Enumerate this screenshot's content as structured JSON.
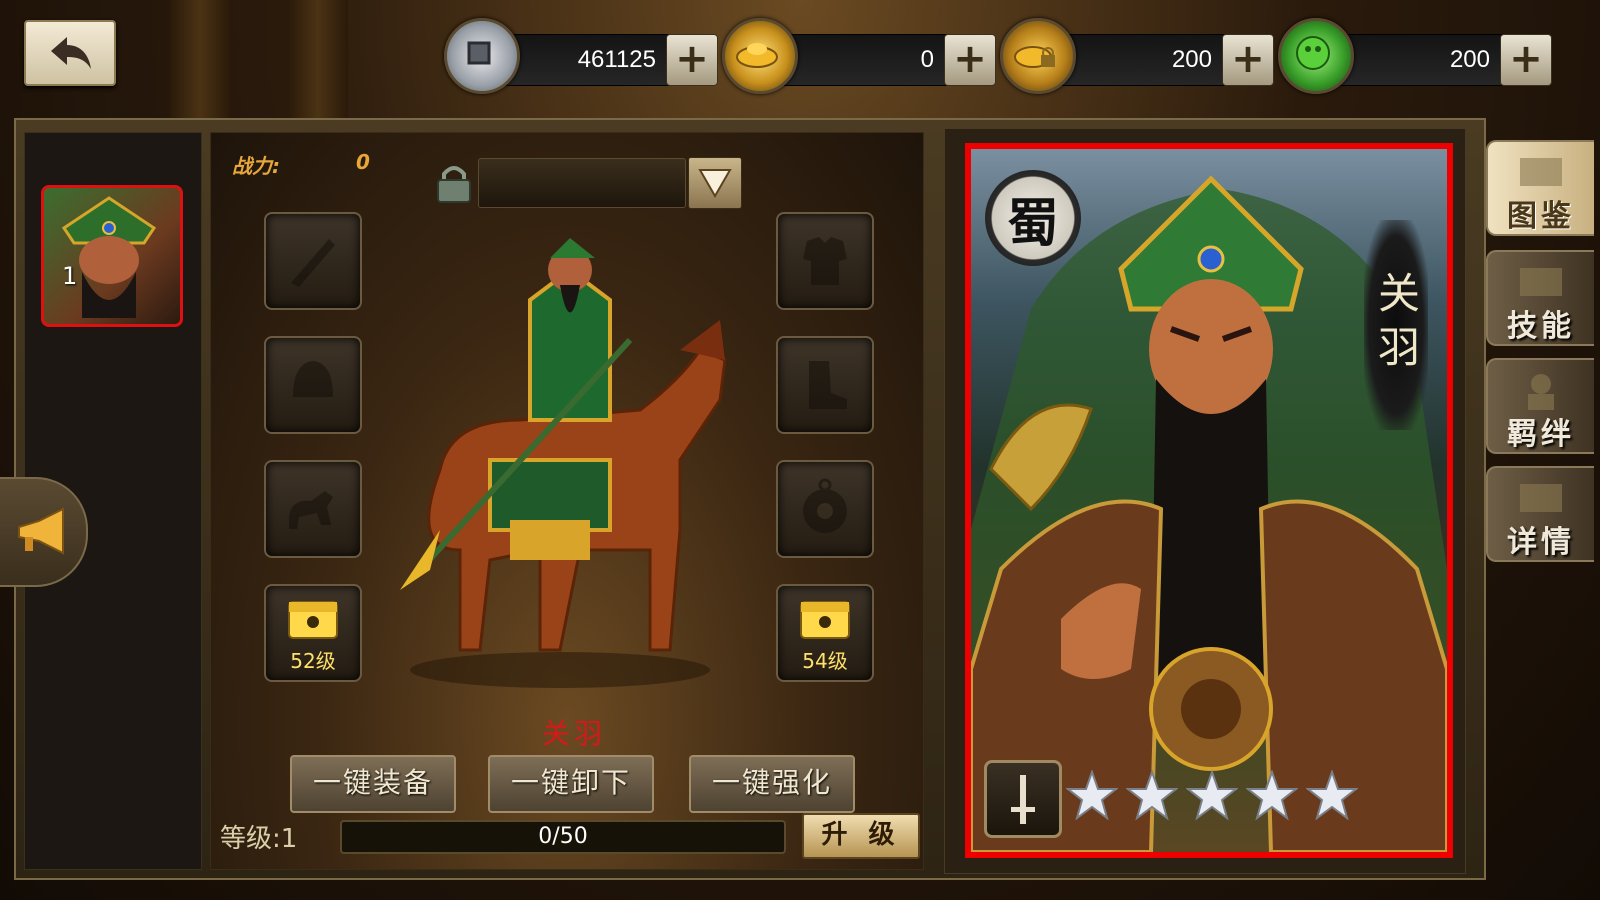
{
  "header": {
    "currencies": [
      {
        "icon": "silver-coin-icon",
        "value": "461125"
      },
      {
        "icon": "gold-ingot-icon",
        "value": "0"
      },
      {
        "icon": "locked-gold-icon",
        "value": "200"
      },
      {
        "icon": "jade-icon",
        "value": "200"
      }
    ]
  },
  "roster": [
    {
      "level": "1"
    }
  ],
  "equip": {
    "power_label": "战力:",
    "power_value": "0",
    "locked_slots": [
      {
        "label": "52级"
      },
      {
        "label": "54级"
      }
    ]
  },
  "hero": {
    "name": "关羽",
    "faction": "蜀",
    "card_name": "关羽",
    "stars": 5
  },
  "actions": {
    "equip_all": "一键装备",
    "unequip_all": "一键卸下",
    "enhance_all": "一键强化"
  },
  "level": {
    "label": "等级:",
    "value": "1",
    "exp_text": "0/50",
    "exp_fraction": 0,
    "upgrade_label": "升 级"
  },
  "side_tabs": [
    {
      "label": "图鉴"
    },
    {
      "label": "技能"
    },
    {
      "label": "羁绊"
    },
    {
      "label": "详情"
    }
  ],
  "colors": {
    "card_border": "#e00000",
    "power_text": "#e8a73a",
    "hero_name": "#d81818"
  }
}
